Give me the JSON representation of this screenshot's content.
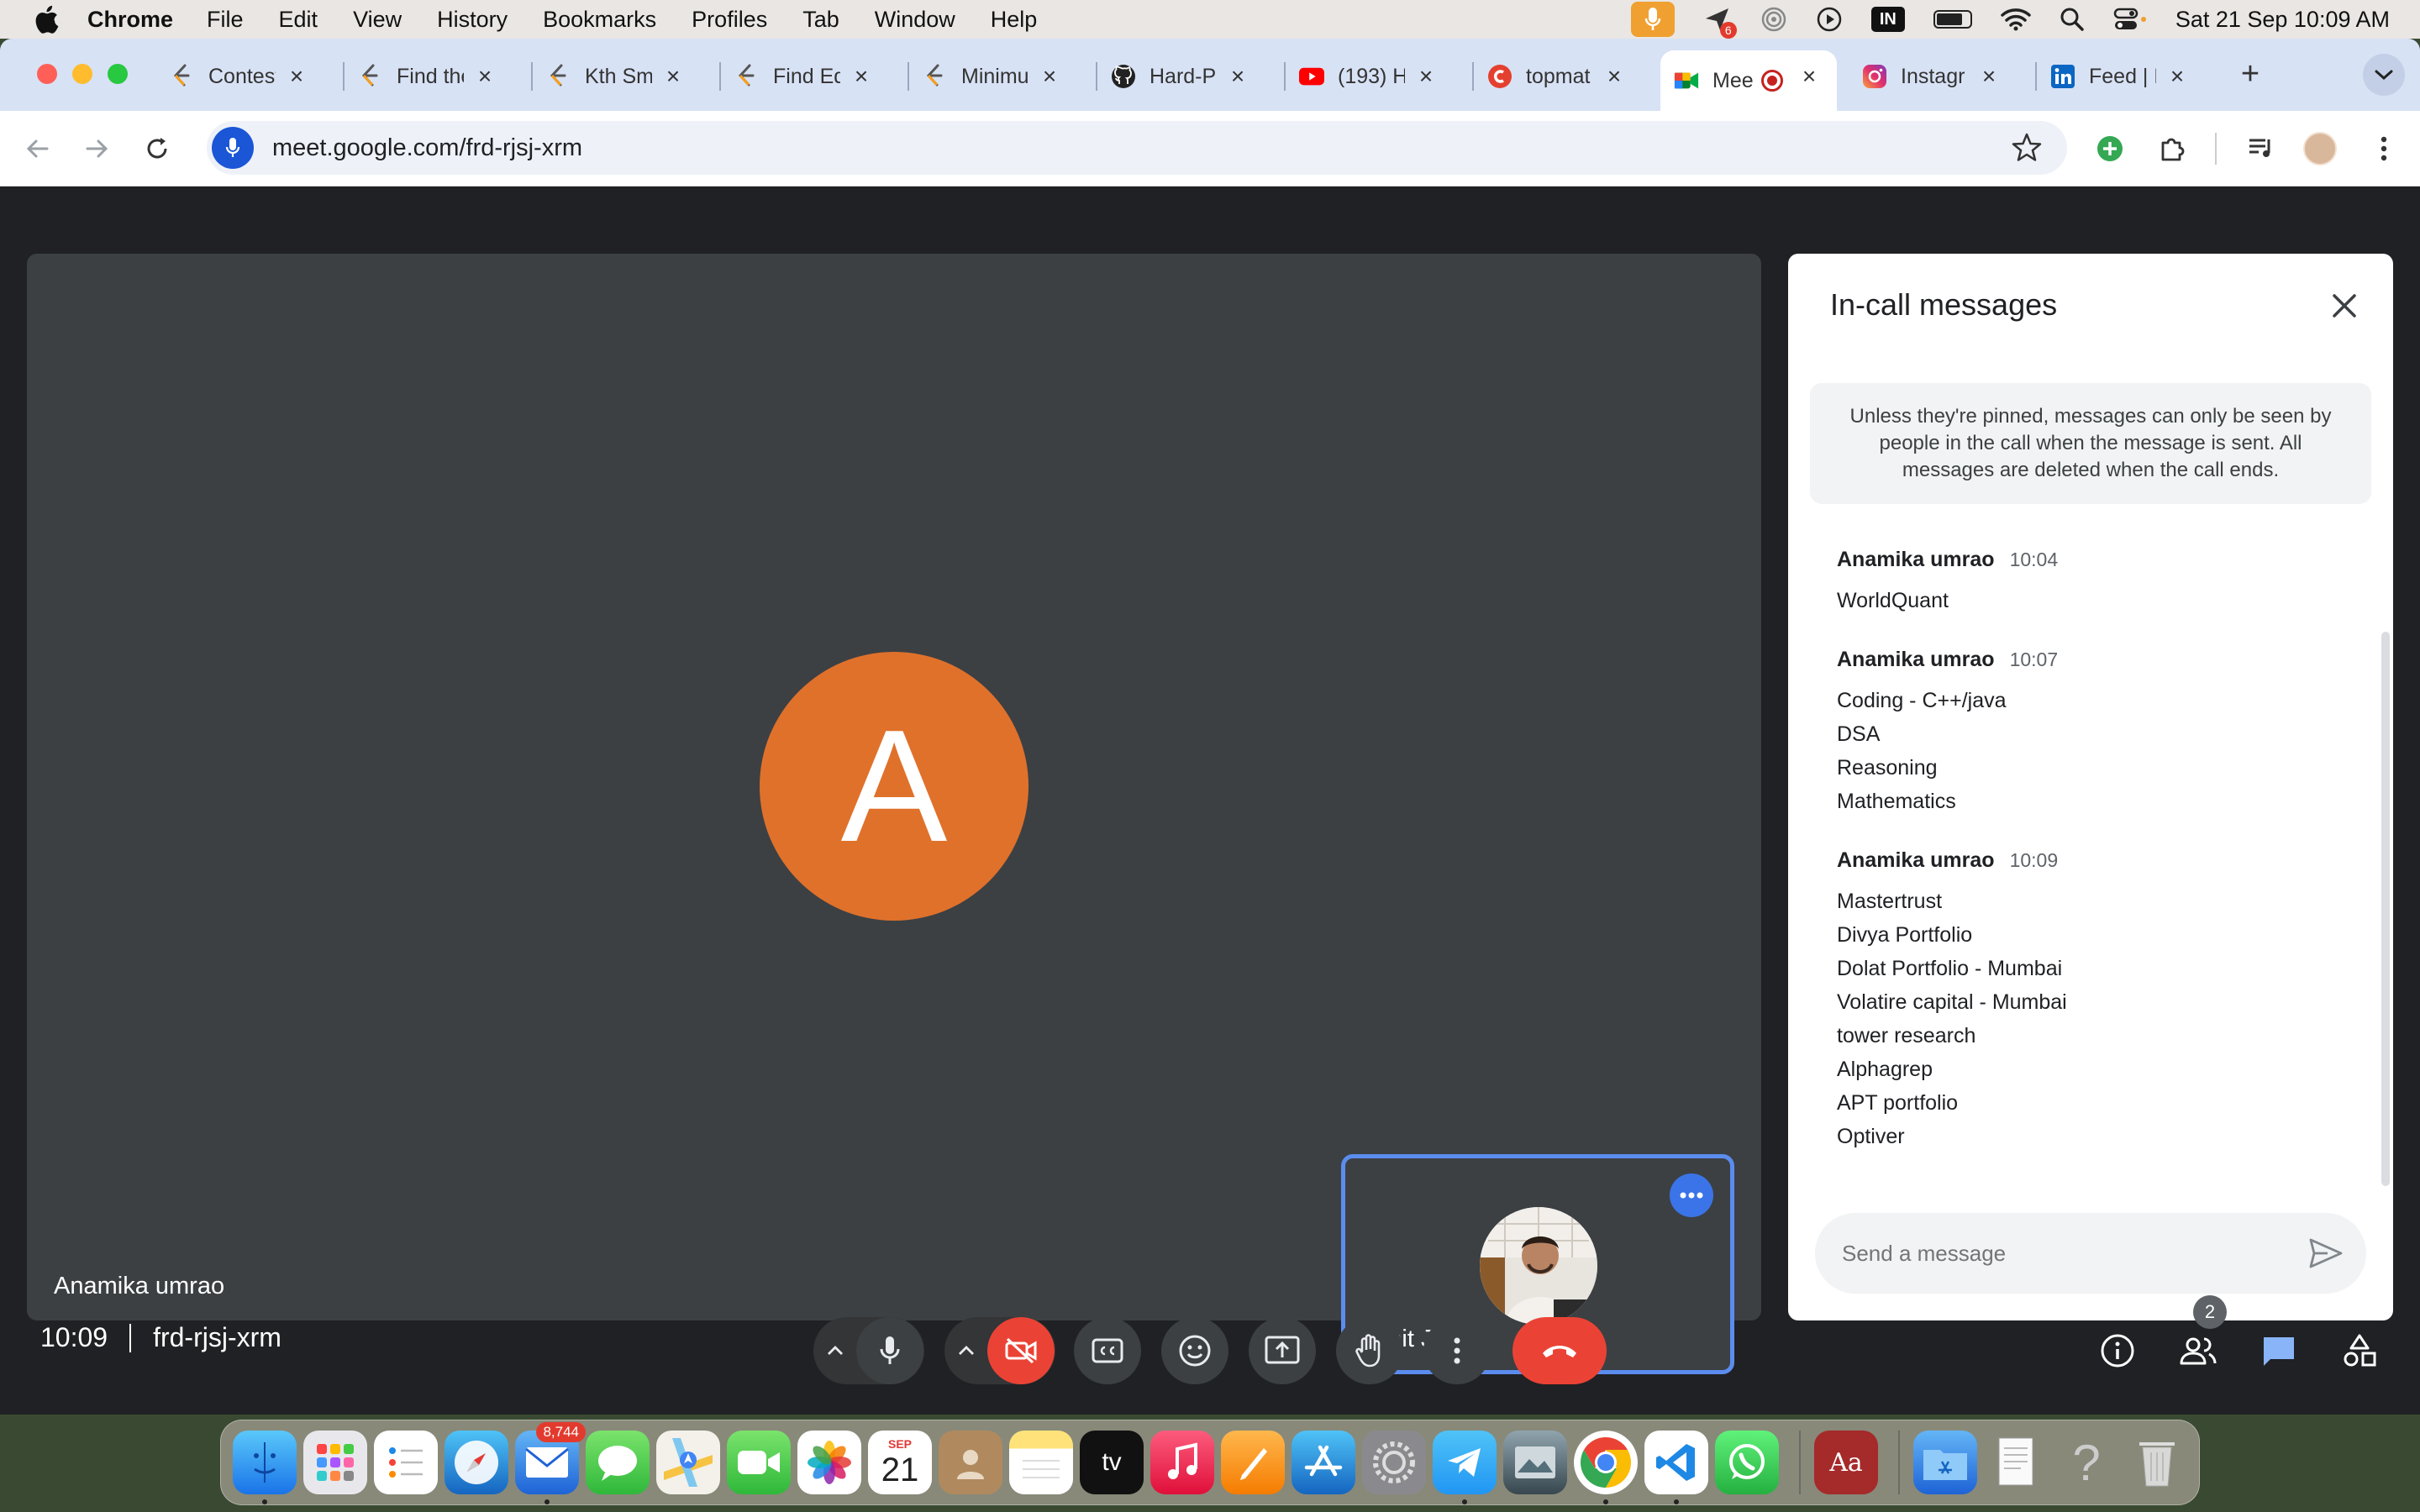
{
  "menubar": {
    "app_name": "Chrome",
    "menus": [
      "File",
      "Edit",
      "View",
      "History",
      "Bookmarks",
      "Profiles",
      "Tab",
      "Window",
      "Help"
    ],
    "notification_count": "6",
    "input_source": "IN",
    "datetime": "Sat 21 Sep  10:09 AM"
  },
  "tabs": [
    {
      "title": "Contest",
      "favicon": "leetcode-icon"
    },
    {
      "title": "Find the",
      "favicon": "leetcode-icon"
    },
    {
      "title": "Kth Sm",
      "favicon": "leetcode-icon"
    },
    {
      "title": "Find Ed",
      "favicon": "leetcode-icon"
    },
    {
      "title": "Minimu",
      "favicon": "leetcode-icon"
    },
    {
      "title": "Hard-P",
      "favicon": "github-icon"
    },
    {
      "title": "(193) H",
      "favicon": "youtube-icon"
    },
    {
      "title": "topmat",
      "favicon": "topmate-icon"
    },
    {
      "title": "Mee",
      "favicon": "meet-icon",
      "active": true
    },
    {
      "title": "Instagr",
      "favicon": "instagram-icon"
    },
    {
      "title": "Feed | L",
      "favicon": "linkedin-icon"
    }
  ],
  "toolbar": {
    "url": "meet.google.com/frd-rjsj-xrm"
  },
  "meet": {
    "main_participant": {
      "initial": "A",
      "name": "Anamika umrao"
    },
    "self_participant": {
      "name": "Vinit Jain"
    },
    "meeting_time": "10:09",
    "meeting_code": "frd-rjsj-xrm",
    "people_count": "2",
    "colors": {
      "accent": "#5b8def",
      "end_call": "#ea4335",
      "avatar_bg": "#e0712b"
    }
  },
  "panel": {
    "title": "In-call messages",
    "note": "Unless they're pinned, messages can only be seen by people in the call when the message is sent. All messages are deleted when the call ends.",
    "messages": [
      {
        "sender": "Anamika umrao",
        "time": "10:04",
        "lines": [
          "WorldQuant"
        ]
      },
      {
        "sender": "Anamika umrao",
        "time": "10:07",
        "lines": [
          "Coding - C++/java",
          "DSA",
          "Reasoning",
          "Mathematics"
        ]
      },
      {
        "sender": "Anamika umrao",
        "time": "10:09",
        "lines": [
          "Mastertrust",
          "Divya Portfolio",
          "Dolat Portfolio - Mumbai",
          "Volatire capital - Mumbai",
          "tower research",
          "Alphagrep",
          "APT portfolio",
          "Optiver"
        ]
      }
    ],
    "input_placeholder": "Send a message"
  },
  "dock": {
    "mail_badge": "8,744",
    "calendar_month": "SEP",
    "calendar_day": "21",
    "tv_label": "tv",
    "dictionary_label": "Aa"
  }
}
